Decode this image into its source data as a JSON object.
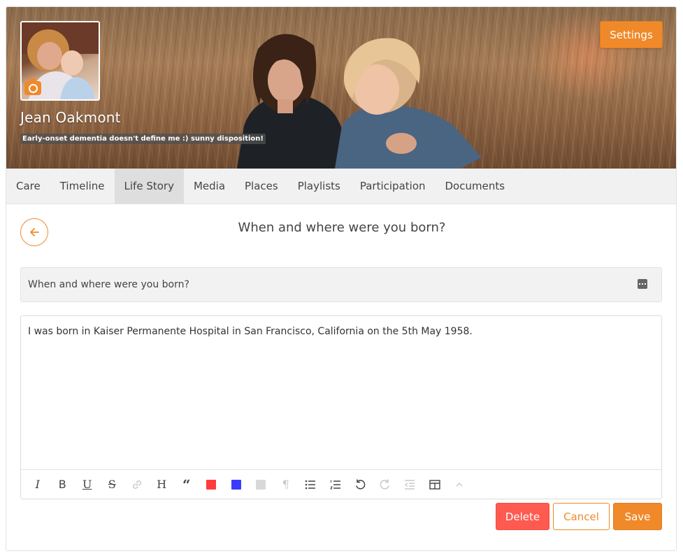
{
  "profile": {
    "name": "Jean Oakmont",
    "tagline": "Early-onset dementia doesn't define me :) sunny disposition!"
  },
  "header": {
    "settings_label": "Settings"
  },
  "tabs": [
    {
      "label": "Care",
      "active": false
    },
    {
      "label": "Timeline",
      "active": false
    },
    {
      "label": "Life Story",
      "active": true
    },
    {
      "label": "Media",
      "active": false
    },
    {
      "label": "Places",
      "active": false
    },
    {
      "label": "Playlists",
      "active": false
    },
    {
      "label": "Participation",
      "active": false
    },
    {
      "label": "Documents",
      "active": false
    }
  ],
  "story": {
    "title": "When and where were you born?",
    "question_value": "When and where were you born?",
    "answer": "I was born in Kaiser Permanente Hospital in San Francisco, California on the 5th May 1958."
  },
  "toolbar": {
    "swatch_colors": [
      "#ff3b3b",
      "#3b3bff",
      "#d8d8d8"
    ]
  },
  "actions": {
    "delete_label": "Delete",
    "cancel_label": "Cancel",
    "save_label": "Save"
  },
  "colors": {
    "accent": "#f0892a",
    "danger": "#ff5a4f"
  }
}
